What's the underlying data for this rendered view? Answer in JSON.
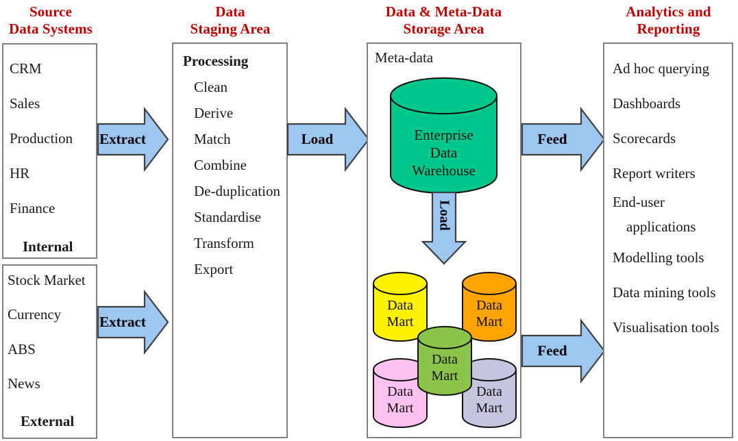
{
  "columns": {
    "source": {
      "title_line1": "Source",
      "title_line2": "Data Systems"
    },
    "staging": {
      "title_line1": "Data",
      "title_line2": "Staging Area"
    },
    "storage": {
      "title_line1": "Data & Meta-Data",
      "title_line2": "Storage Area"
    },
    "analytics": {
      "title_line1": "Analytics and",
      "title_line2": "Reporting"
    }
  },
  "source_internal": {
    "items": [
      "CRM",
      "Sales",
      "Production",
      "HR",
      "Finance"
    ],
    "footer": "Internal"
  },
  "source_external": {
    "items": [
      "Stock Market",
      "Currency",
      "ABS",
      "News"
    ],
    "footer": "External"
  },
  "staging": {
    "heading": "Processing",
    "steps": [
      "Clean",
      "Derive",
      "Match",
      "Combine",
      "De-duplication",
      "Standardise",
      "Transform",
      "Export"
    ]
  },
  "storage": {
    "metadata_label": "Meta-data",
    "warehouse": {
      "line1": "Enterprise",
      "line2": "Data",
      "line3": "Warehouse",
      "color": "#00C88C"
    },
    "load_arrow_label": "Load",
    "data_marts": [
      {
        "id": "mart-yellow",
        "line1": "Data",
        "line2": "Mart",
        "color": "#FFF200"
      },
      {
        "id": "mart-orange",
        "line1": "Data",
        "line2": "Mart",
        "color": "#FFA400"
      },
      {
        "id": "mart-green",
        "line1": "Data",
        "line2": "Mart",
        "color": "#8CC34A"
      },
      {
        "id": "mart-pink",
        "line1": "Data",
        "line2": "Mart",
        "color": "#FFC2F0"
      },
      {
        "id": "mart-lavender",
        "line1": "Data",
        "line2": "Mart",
        "color": "#C5C5E0"
      }
    ]
  },
  "analytics": {
    "items": [
      "Ad hoc querying",
      "Dashboards",
      "Scorecards",
      "Report writers",
      "End-user",
      "applications",
      "Modelling tools",
      "Data mining tools",
      "Visualisation tools"
    ]
  },
  "arrows": {
    "extract_top": "Extract",
    "extract_bottom": "Extract",
    "load": "Load",
    "feed_top": "Feed",
    "feed_bottom": "Feed"
  },
  "colors": {
    "heading_red": "#C00000",
    "arrow_fill": "#9DC6F0",
    "arrow_stroke": "#404040",
    "panel_border": "#808080"
  }
}
